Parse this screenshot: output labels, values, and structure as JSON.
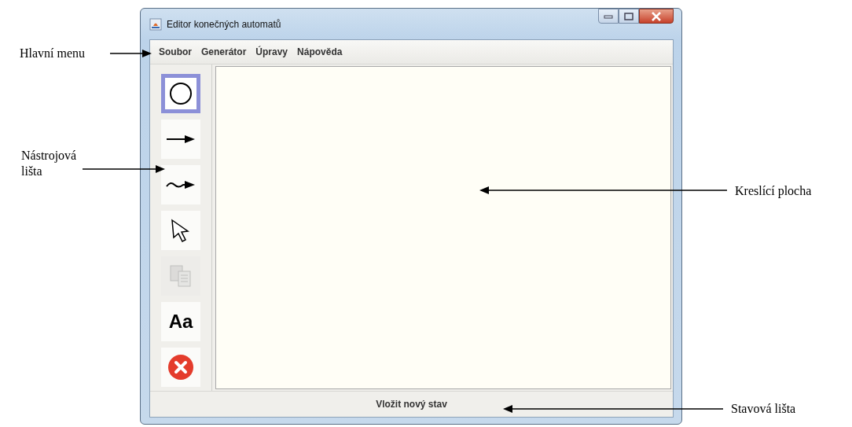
{
  "window": {
    "title": "Editor konečných automatů"
  },
  "menu": [
    "Soubor",
    "Generátor",
    "Úpravy",
    "Nápověda"
  ],
  "tools": [
    {
      "kind": "state",
      "selected": true,
      "disabled": false
    },
    {
      "kind": "arrow",
      "selected": false,
      "disabled": false
    },
    {
      "kind": "wave-arrow",
      "selected": false,
      "disabled": false
    },
    {
      "kind": "pointer",
      "selected": false,
      "disabled": false
    },
    {
      "kind": "copy",
      "selected": false,
      "disabled": true
    },
    {
      "kind": "text",
      "label": "Aa",
      "selected": false,
      "disabled": false
    },
    {
      "kind": "delete",
      "selected": false,
      "disabled": false
    }
  ],
  "status_bar": "Vložit nový stav",
  "annotations": [
    {
      "kind": "menu",
      "text": "Hlavní menu"
    },
    {
      "kind": "toolbar",
      "text": "Nástrojová lišta"
    },
    {
      "kind": "canvas",
      "text": "Kreslící plocha"
    },
    {
      "kind": "status",
      "text": "Stavová lišta"
    }
  ]
}
